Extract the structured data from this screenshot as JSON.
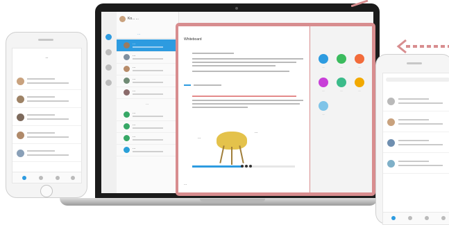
{
  "laptop_app": {
    "user_name": "Ko... ...",
    "list_tabs": "...",
    "conversations": [
      {
        "name": "...",
        "time": "",
        "color": "#9c7b5f",
        "active": true
      },
      {
        "name": "...",
        "time": "",
        "color": "#7f8f9f",
        "active": false
      },
      {
        "name": "...",
        "time": "",
        "color": "#b88c6a",
        "active": false
      },
      {
        "name": "...",
        "time": "",
        "color": "#6f8a74",
        "active": false
      },
      {
        "name": "...",
        "time": "",
        "color": "#8b6b6b",
        "active": false
      }
    ],
    "section_label": "...",
    "spaces": [
      {
        "name": "...",
        "color": "#37a866"
      },
      {
        "name": "...",
        "color": "#37a866"
      },
      {
        "name": "...",
        "color": "#37a866"
      },
      {
        "name": "...",
        "color": "#2aa0d8"
      }
    ]
  },
  "whiteboard": {
    "title": "Whiteboard",
    "sticky_1": "...",
    "sticky_2": "...",
    "footer": "...",
    "progress_fraction": 0.49,
    "tools": [
      {
        "label": "...",
        "color": "#2d9be0"
      },
      {
        "label": "...",
        "color": "#3bbb5e"
      },
      {
        "label": "...",
        "color": "#f26b3a"
      },
      {
        "label": "...",
        "color": "#c83fd8"
      },
      {
        "label": "...",
        "color": "#3bbb8a"
      },
      {
        "label": "...",
        "color": "#f2a900"
      },
      {
        "label": "...",
        "color": "#7fc4e8"
      }
    ]
  },
  "phone_left": {
    "title": "...",
    "avatars": [
      "#c9a27e",
      "#9e8366",
      "#7d6a5c",
      "#b08a6a",
      "#8aa0b8"
    ]
  },
  "phone_right": {
    "avatars": [
      "#b9b9b9",
      "#c9a27e",
      "#6f8fb0",
      "#7fb0c8"
    ]
  },
  "colors": {
    "accent": "#2d9be0",
    "highlight_frame": "#d88d8f",
    "arrow": "#d88d8f"
  }
}
